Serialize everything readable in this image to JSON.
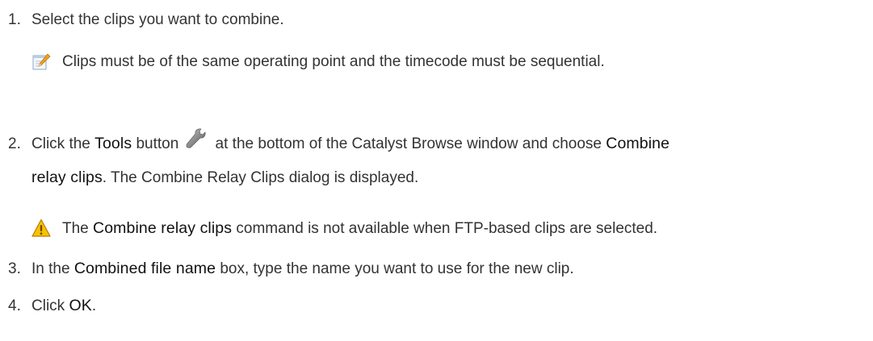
{
  "steps": [
    {
      "number": "1.",
      "text": "Select the clips you want to combine."
    },
    {
      "number": "2.",
      "part_a": "Click the ",
      "ui_tools": "Tools",
      "part_b": " button",
      "part_c": " at the bottom of the Catalyst Browse window and choose ",
      "ui_combine": "Combine",
      "ui_relay_clips": "relay clips",
      "part_d": ". The Combine Relay Clips dialog is displayed."
    },
    {
      "number": "3.",
      "part_a": "In the ",
      "ui_field": "Combined file name",
      "part_b": " box, type the name you want to use for the new clip."
    },
    {
      "number": "4.",
      "part_a": "Click ",
      "ui_ok": "OK",
      "part_b": "."
    }
  ],
  "notes": {
    "note1": {
      "icon": "notepad-pencil-icon",
      "text": "Clips must be of the same operating point and the timecode must be sequential."
    },
    "note2": {
      "icon": "warning-triangle-icon",
      "part_a": "The ",
      "ui_command": "Combine relay clips",
      "part_b": " command is not available when FTP-based clips are selected."
    }
  },
  "icons": {
    "tools": "wrench-icon"
  },
  "colors": {
    "text": "#333333",
    "warning": "#f5c400",
    "note_pencil": "#f0a020"
  }
}
